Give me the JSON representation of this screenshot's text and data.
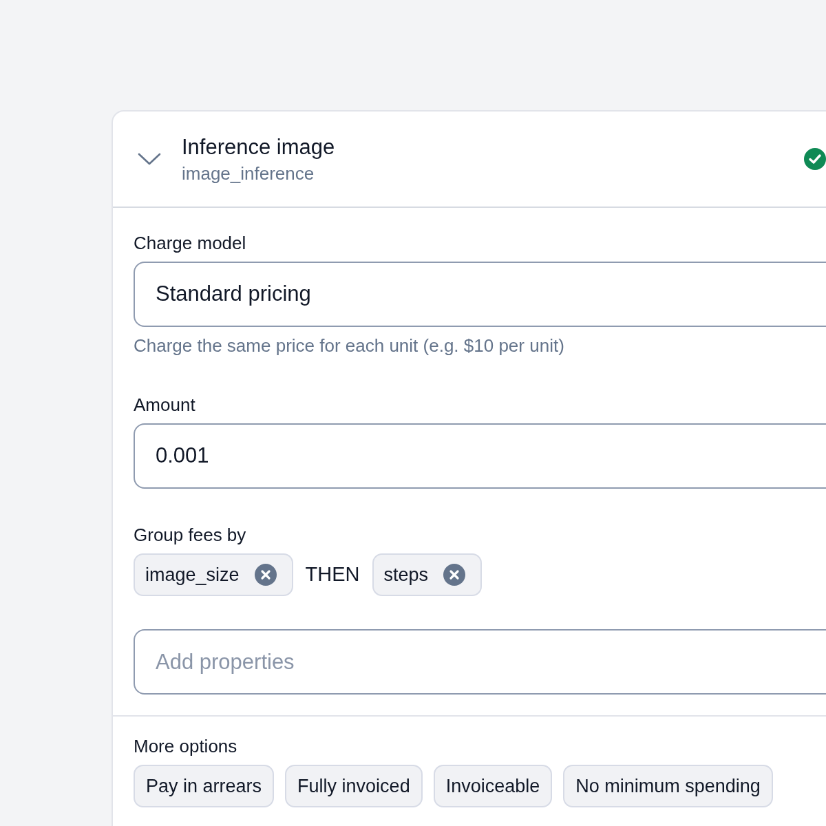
{
  "card": {
    "title": "Inference image",
    "subtitle": "image_inference",
    "expanded": true,
    "valid": true
  },
  "charge_model": {
    "label": "Charge model",
    "value": "Standard pricing",
    "hint": "Charge the same price for each unit (e.g. $10 per unit)"
  },
  "amount": {
    "label": "Amount",
    "value": "0.001"
  },
  "group_fees": {
    "label": "Group fees by",
    "separator": "THEN",
    "properties": [
      {
        "label": "image_size"
      },
      {
        "label": "steps"
      }
    ],
    "add_field": {
      "placeholder": "Add properties"
    }
  },
  "more_options": {
    "label": "More options",
    "options": [
      {
        "label": "Pay in arrears"
      },
      {
        "label": "Fully invoiced"
      },
      {
        "label": "Invoiceable"
      },
      {
        "label": "No minimum spending"
      }
    ]
  }
}
